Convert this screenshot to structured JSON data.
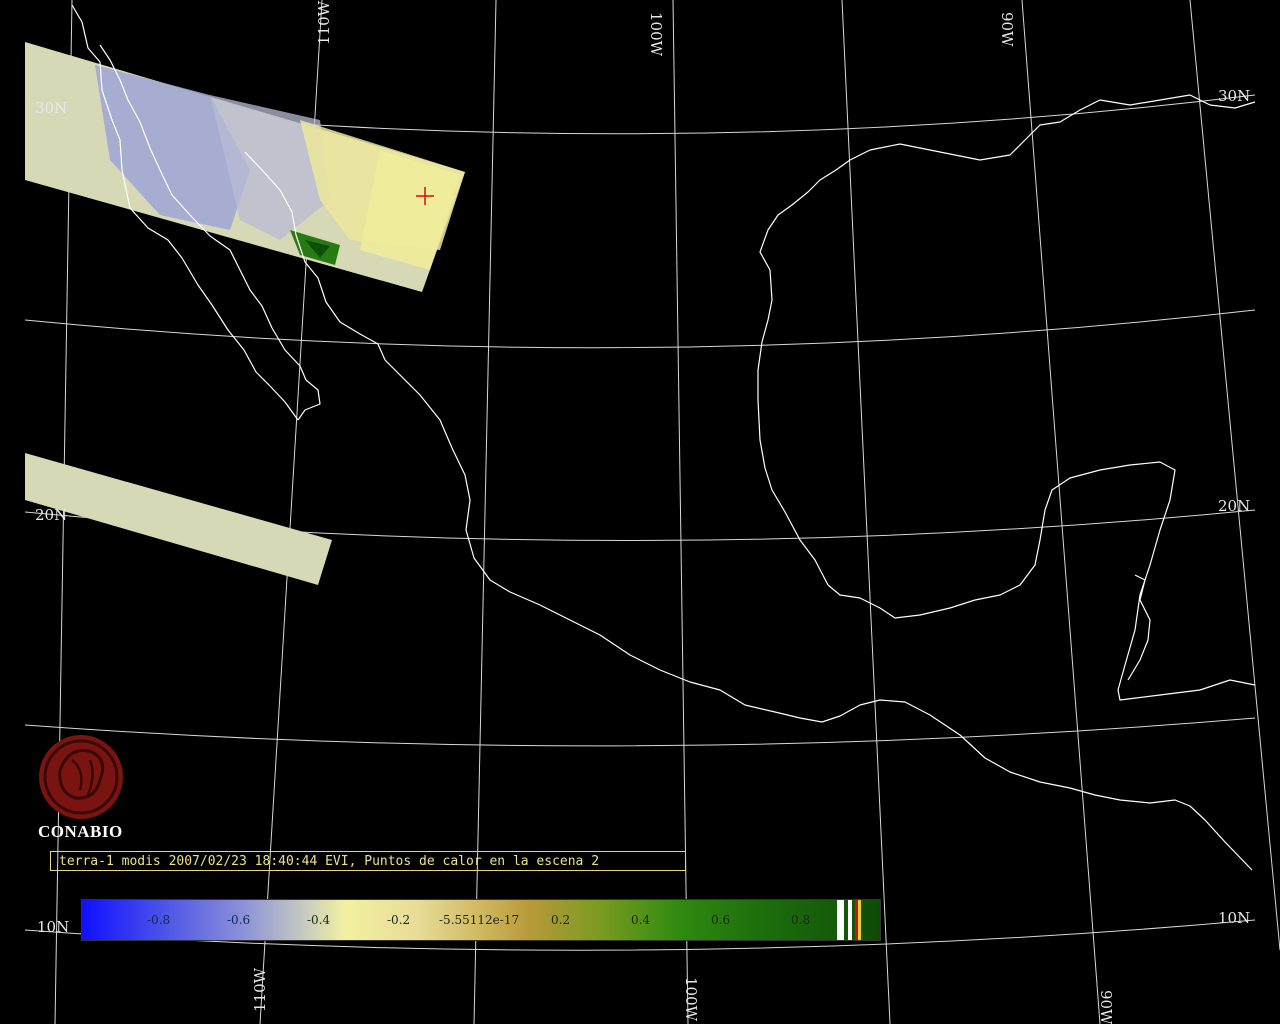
{
  "map": {
    "latitude_labels": [
      "30N",
      "30N",
      "20N",
      "20N",
      "10N",
      "10N"
    ],
    "longitude_labels": [
      "110W",
      "100W",
      "90W",
      "110W",
      "100W",
      "90W"
    ],
    "colors": {
      "background": "#000000",
      "coastline": "#ffffff",
      "graticule": "#d8d8d8",
      "swath_fill": "#d6d8b6",
      "hotspot_marker": "#d01010"
    }
  },
  "logo": {
    "text": "CONABIO",
    "color": "#7a1410"
  },
  "caption": {
    "text": "terra-1 modis 2007/02/23 18:40:44 EVI, Puntos de calor en la escena 2"
  },
  "colorbar": {
    "ticks": [
      "-0.8",
      "-0.6",
      "-0.4",
      "-0.2",
      "-5.55112e-17",
      "0.2",
      "0.4",
      "0.6",
      "0.8"
    ]
  }
}
